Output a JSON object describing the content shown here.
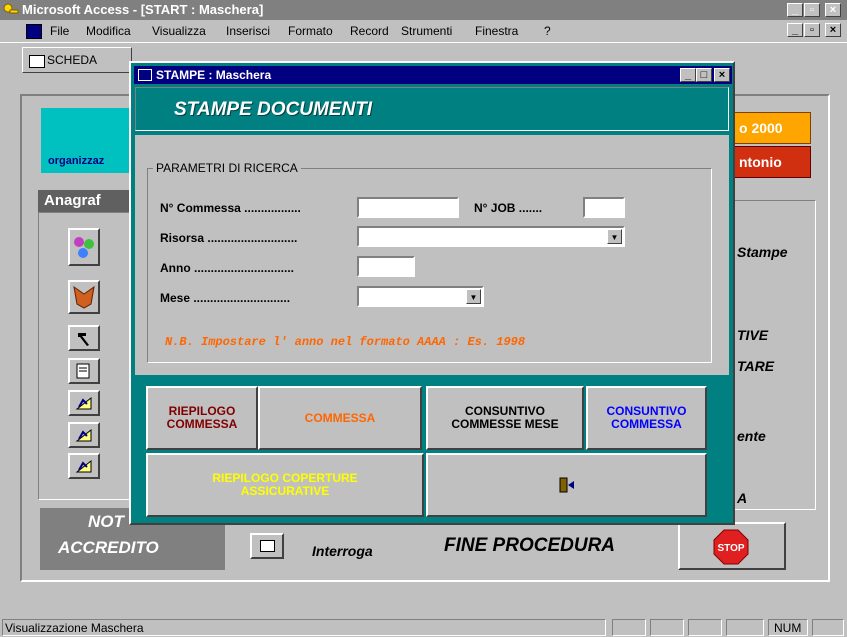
{
  "app": {
    "title": "Microsoft Access - [START : Maschera]"
  },
  "menu": [
    "File",
    "Modifica",
    "Visualizza",
    "Inserisci",
    "Formato",
    "Record",
    "Strumenti",
    "Finestra",
    "?"
  ],
  "toolbar": {
    "tab_label": "SCHEDA"
  },
  "background_form": {
    "cyan_label": "organizzaz",
    "anagrafi_label": "Anagraf",
    "year_label": "o 2000",
    "name_label": "ntonio",
    "right_labels": [
      "Stampe",
      "TIVE",
      "TARE",
      "ente",
      "A"
    ],
    "nota_label": "NOT",
    "accredito_label": "ACCREDITO",
    "interroga_label": "Interroga",
    "fine_label": "FINE PROCEDURA",
    "stop_label": "STOP"
  },
  "dialog": {
    "title": "STAMPE : Maschera",
    "header": "STAMPE DOCUMENTI",
    "group_label": "PARAMETRI DI RICERCA",
    "fields": {
      "commessa": "N° Commessa .................",
      "job": "N° JOB .......",
      "risorsa": "Risorsa ...........................",
      "anno": "Anno ..............................",
      "mese": "Mese ............................."
    },
    "values": {
      "commessa": "",
      "job": "",
      "risorsa": "",
      "anno": "",
      "mese": ""
    },
    "note": "N.B. Impostare l' anno nel formato AAAA : Es. 1998",
    "buttons": {
      "riepilogo_commessa": "RIEPILOGO COMMESSA",
      "commessa": "COMMESSA",
      "consuntivo_mese": "CONSUNTIVO COMMESSE MESE",
      "consuntivo_commessa": "CONSUNTIVO COMMESSA",
      "riepilogo_coperture": "RIEPILOGO COPERTURE ASSICURATIVE"
    }
  },
  "status": {
    "text": "Visualizzazione Maschera",
    "num": "NUM"
  },
  "colors": {
    "teal": "#008080",
    "navy": "#000080",
    "orange": "#ff6600",
    "brown": "#800000",
    "blue": "#0000ff",
    "yellow": "#ffff00",
    "cyan": "#00c0c0"
  }
}
